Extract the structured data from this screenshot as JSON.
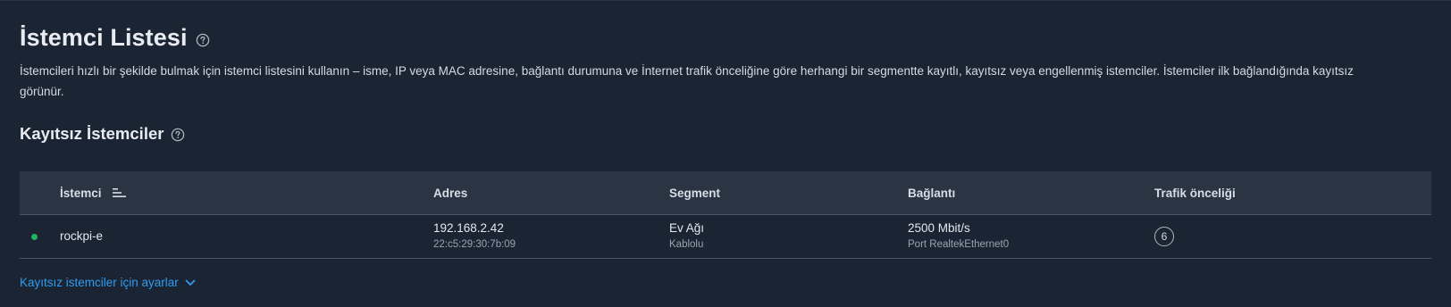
{
  "page": {
    "title": "İstemci Listesi",
    "description": "İstemcileri hızlı bir şekilde bulmak için istemci listesini kullanın – isme, IP veya MAC adresine, bağlantı durumuna ve İnternet trafik önceliğine göre herhangi bir segmentte kayıtlı, kayıtsız veya engellenmiş istemciler. İstemciler ilk bağlandığında kayıtsız görünür."
  },
  "section": {
    "title": "Kayıtsız İstemciler"
  },
  "table": {
    "columns": {
      "client": "İstemci",
      "address": "Adres",
      "segment": "Segment",
      "connection": "Bağlantı",
      "priority": "Trafik önceliği"
    },
    "rows": [
      {
        "status": "online",
        "status_color": "#1fb55e",
        "name": "rockpi-e",
        "ip": "192.168.2.42",
        "mac": "22:c5:29:30:7b:09",
        "segment": "Ev Ağı",
        "segment_type": "Kablolu",
        "speed": "2500 Mbit/s",
        "port": "Port RealtekEthernet0",
        "priority": "6"
      }
    ]
  },
  "footer": {
    "settings_link": "Kayıtsız istemciler için ayarlar"
  },
  "colors": {
    "background": "#1b2433",
    "header_bg": "#2b3443",
    "link": "#2f9cf0"
  },
  "icons": {
    "help": "help-circle-icon",
    "sort": "sort-icon",
    "chevron": "chevron-down-icon"
  }
}
